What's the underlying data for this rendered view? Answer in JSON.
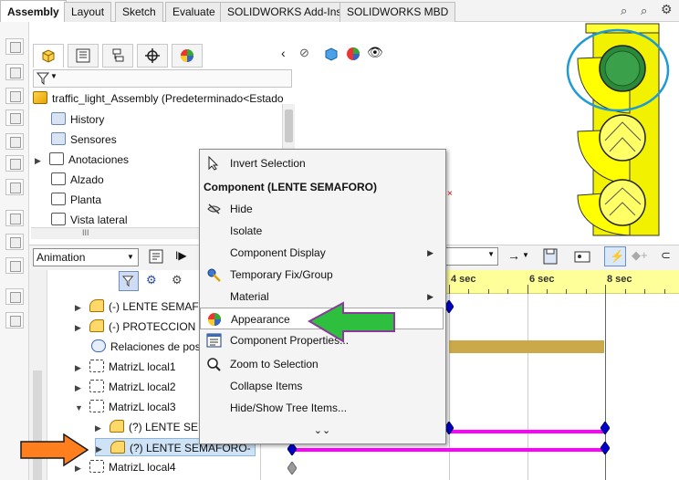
{
  "tabs": [
    "Assembly",
    "Layout",
    "Sketch",
    "Evaluate",
    "SOLIDWORKS Add-Ins",
    "SOLIDWORKS MBD"
  ],
  "tree": {
    "root": "traffic_light_Assembly  (Predeterminado<Estado",
    "items": [
      "History",
      "Sensores",
      "Anotaciones",
      "Alzado",
      "Planta",
      "Vista lateral"
    ],
    "hscroll_glyph": "III"
  },
  "animation": {
    "study_type": "Animation",
    "play_glyph": "I▶",
    "items": [
      "(-) LENTE SEMAFO",
      "(-) PROTECCION L",
      "Relaciones de pos",
      "MatrizL local1",
      "MatrizL local2",
      "MatrizL local3",
      "(?) LENTE SEM",
      "(?) LENTE SEMAFORO-",
      "MatrizL local4"
    ]
  },
  "timeline": {
    "labels": [
      "4 sec",
      "6 sec",
      "8 sec"
    ]
  },
  "context_menu": {
    "items": [
      {
        "label": "Invert Selection",
        "icon": "cursor-icon"
      },
      {
        "label": "Component (LENTE SEMAFORO)",
        "header": true
      },
      {
        "label": "Hide",
        "icon": "hide-icon"
      },
      {
        "label": "Isolate"
      },
      {
        "label": "Component Display",
        "submenu": true
      },
      {
        "label": "Temporary Fix/Group",
        "icon": "fix-icon"
      },
      {
        "label": "Material",
        "submenu": true
      },
      {
        "label": "Appearance",
        "icon": "appearance-icon",
        "highlighted": true
      },
      {
        "label": "Component Properties...",
        "icon": "properties-icon"
      },
      {
        "label": "Zoom to Selection",
        "icon": "zoom-icon"
      },
      {
        "label": "Collapse Items"
      },
      {
        "label": "Hide/Show Tree Items..."
      }
    ],
    "more_glyph": "⌄⌄"
  },
  "colors": {
    "traffic_light_body": "#ffff00",
    "lens_active": "#2a8a3a",
    "highlight_circle": "#1e9ad6",
    "arrow_green": "#2fbf3f",
    "arrow_orange": "#ff7f1f",
    "timeline_bar": "#ff00ff",
    "keyframe": "#0000cc"
  }
}
